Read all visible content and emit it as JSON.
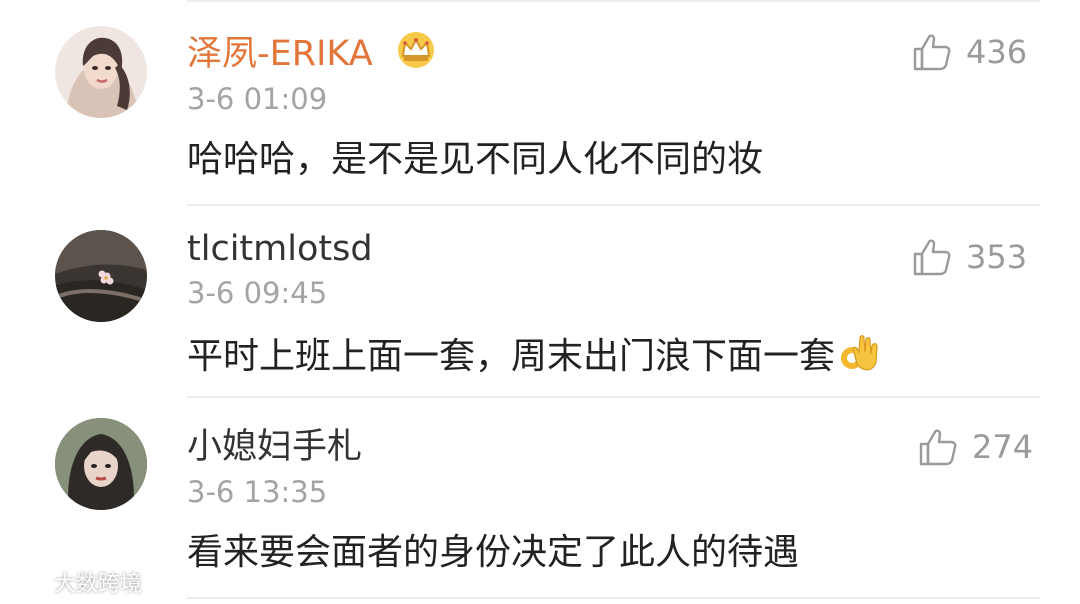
{
  "comments": [
    {
      "username": "泽夙-ERIKA",
      "time": "3-6 01:09",
      "content": "哈哈哈，是不是见不同人化不同的妆",
      "likes": "436",
      "badge": "crown-icon"
    },
    {
      "username": "tlcitmlotsd",
      "time": "3-6 09:45",
      "content": "平时上班上面一套，周末出门浪下面一套",
      "likes": "353",
      "emoji": "ok-hand-icon"
    },
    {
      "username": "小媳妇手札",
      "time": "3-6 13:35",
      "content": "看来要会面者的身份决定了此人的待遇",
      "likes": "274"
    }
  ],
  "watermark": {
    "text": "大数跨境"
  },
  "colors": {
    "vip_username": "#e2763a",
    "username": "#333333",
    "time": "#a4a4a4",
    "content": "#222222",
    "like": "#9a9a9a"
  }
}
